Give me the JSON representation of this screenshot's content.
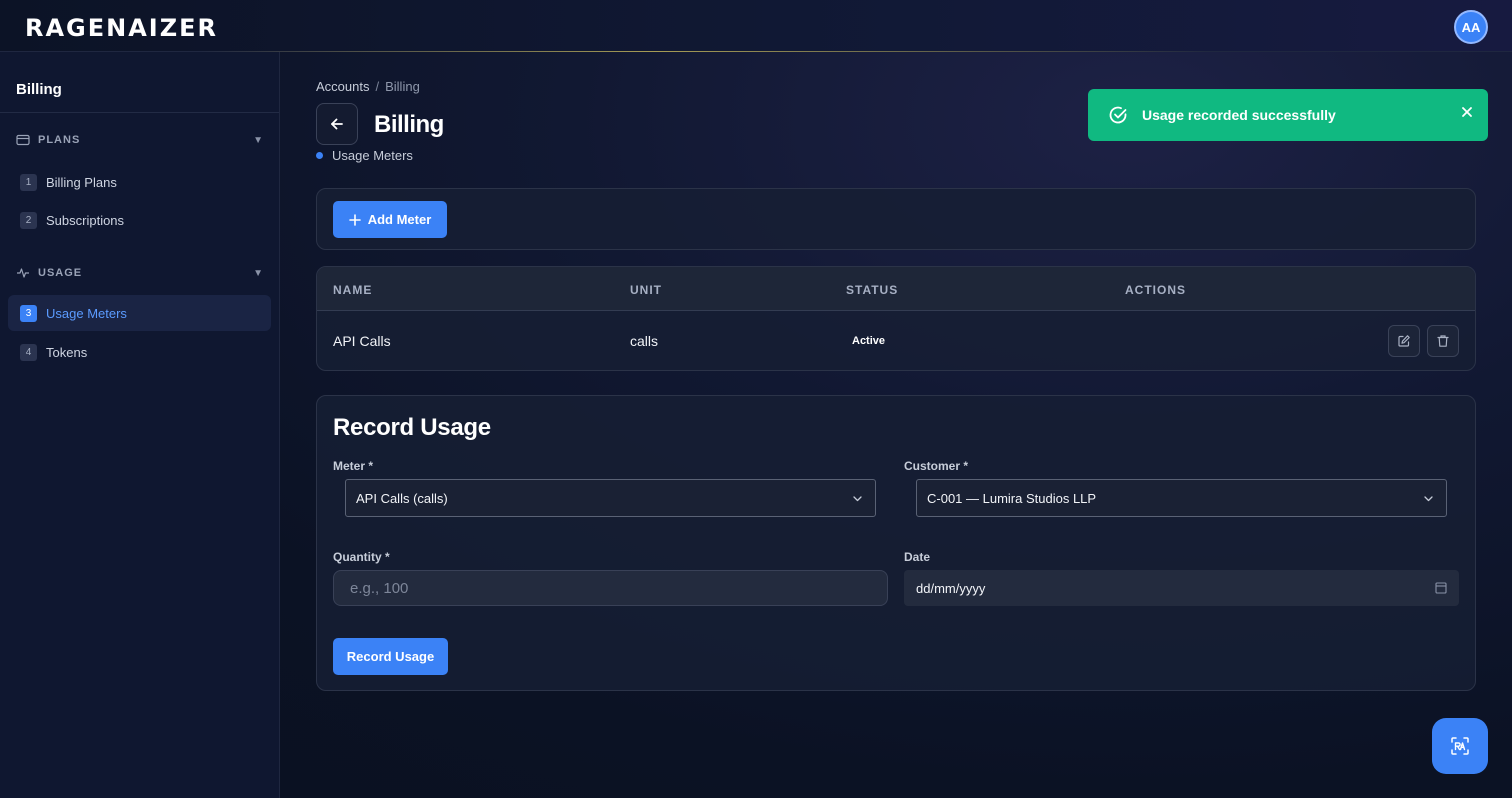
{
  "app": {
    "logo_text": "RAGENAIZER",
    "user_initials": "AA"
  },
  "sidebar": {
    "title": "Billing",
    "sections": [
      {
        "label": "PLANS",
        "icon": "credit-card-icon",
        "items": [
          {
            "num": "1",
            "label": "Billing Plans"
          },
          {
            "num": "2",
            "label": "Subscriptions"
          }
        ]
      },
      {
        "label": "USAGE",
        "icon": "activity-icon",
        "items": [
          {
            "num": "3",
            "label": "Usage Meters",
            "active": true
          },
          {
            "num": "4",
            "label": "Tokens"
          }
        ]
      }
    ]
  },
  "breadcrumb": {
    "items": [
      "Accounts",
      "Billing"
    ],
    "separator": "/"
  },
  "page": {
    "title": "Billing",
    "subnav_label": "Usage Meters"
  },
  "toast": {
    "message": "Usage recorded successfully",
    "type": "success",
    "color": "#10b981"
  },
  "toolbar": {
    "add_meter_label": "Add Meter"
  },
  "table": {
    "columns": [
      "NAME",
      "UNIT",
      "STATUS",
      "ACTIONS"
    ],
    "rows": [
      {
        "name": "API Calls",
        "unit": "calls",
        "status": "Active"
      }
    ]
  },
  "record_form": {
    "title": "Record Usage",
    "meter_label": "Meter *",
    "meter_value": "API Calls (calls)",
    "customer_label": "Customer *",
    "customer_value": "C-001 — Lumira Studios LLP",
    "quantity_label": "Quantity *",
    "quantity_placeholder": "e.g., 100",
    "date_label": "Date",
    "date_value": "dd/mm/yyyy",
    "submit_label": "Record Usage"
  },
  "colors": {
    "accent": "#3b82f6",
    "success": "#10b981",
    "background": "#0b1224"
  }
}
